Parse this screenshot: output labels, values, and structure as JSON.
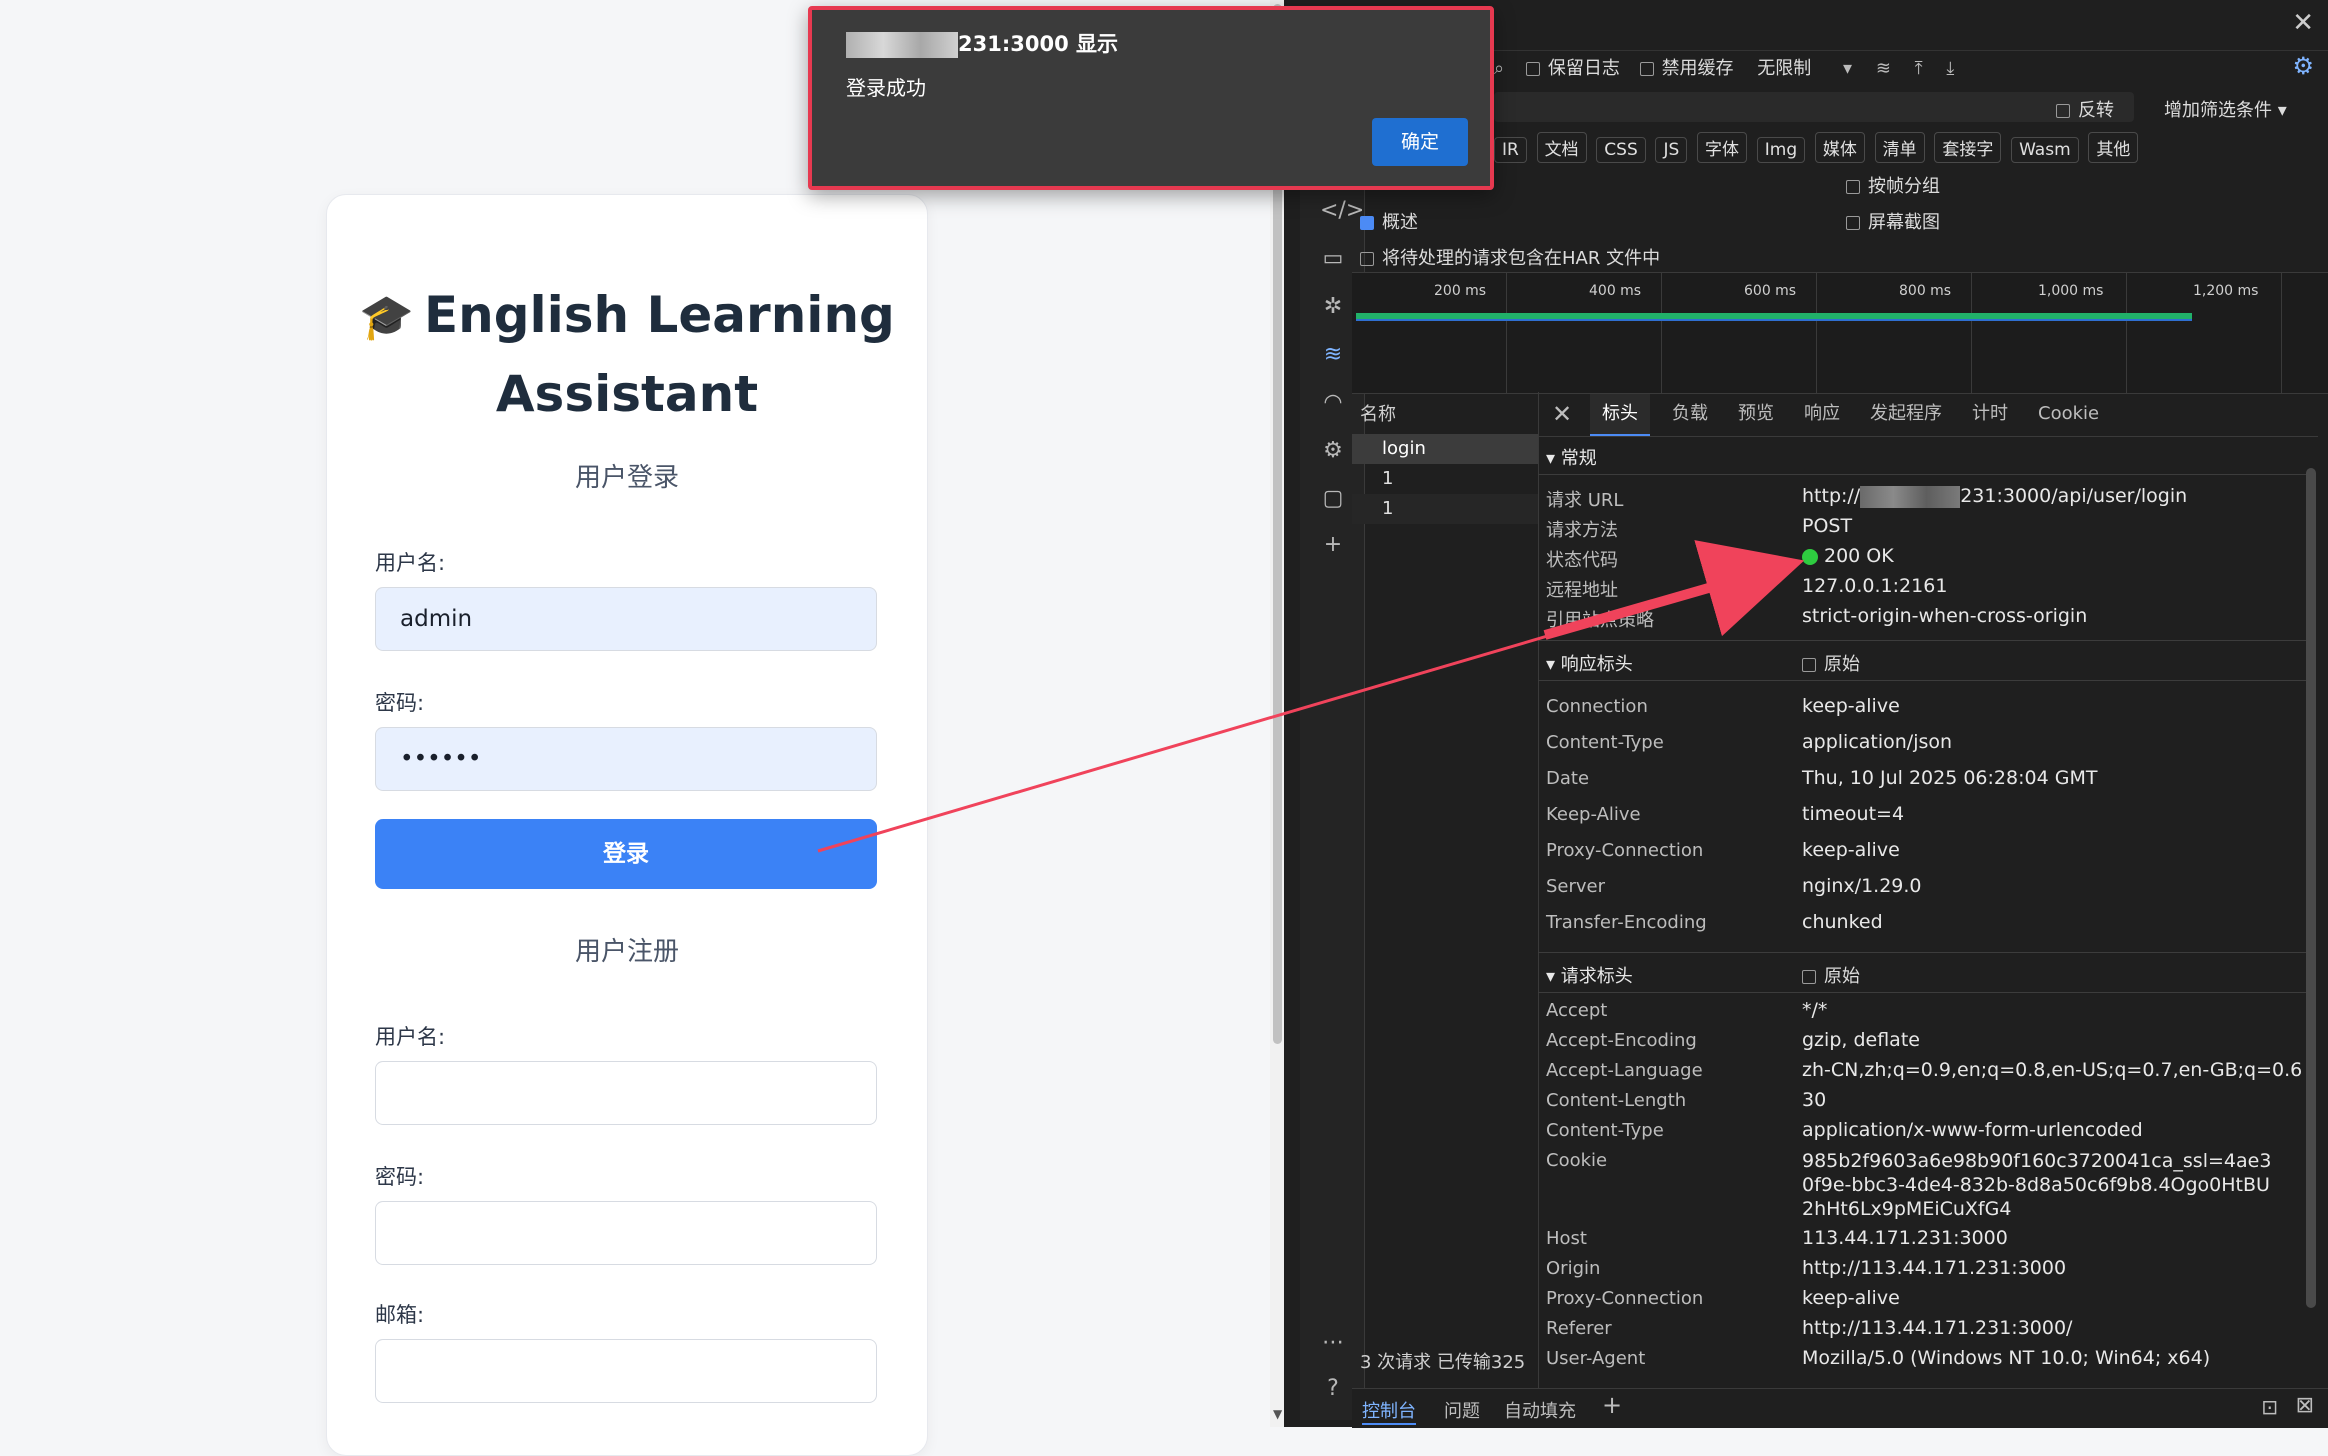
{
  "login_page": {
    "title_icon": "graduation-cap-icon",
    "title_line1": "English Learning",
    "title_line2": "Assistant",
    "login_heading": "用户登录",
    "username_label": "用户名:",
    "username_value": "admin",
    "password_label": "密码:",
    "password_value": "••••••",
    "login_button": "登录",
    "register_heading": "用户注册",
    "reg_username_label": "用户名:",
    "reg_password_label": "密码:",
    "reg_email_label": "邮箱:"
  },
  "dialog": {
    "origin_suffix": "231:3000 显示",
    "message": "登录成功",
    "ok_button": "确定"
  },
  "devtools": {
    "toolbar": {
      "preserve_log": "保留日志",
      "disable_cache": "禁用缓存",
      "throttle": "无限制",
      "invert": "反转",
      "more_filters": "增加筛选条件"
    },
    "filter_types": [
      "IR",
      "文档",
      "CSS",
      "JS",
      "字体",
      "Img",
      "媒体",
      "清单",
      "套接字",
      "Wasm",
      "其他"
    ],
    "options": {
      "group_by_frame": "按帧分组",
      "overview": "概述",
      "screenshots": "屏幕截图",
      "har_pending": "将待处理的请求包含在HAR 文件中"
    },
    "timeline_ticks": [
      "200 ms",
      "400 ms",
      "600 ms",
      "800 ms",
      "1,000 ms",
      "1,200 ms"
    ],
    "request_list": {
      "header": "名称",
      "rows": [
        "login",
        "1",
        "1"
      ],
      "status": "3 次请求  已传输325"
    },
    "detail_tabs": [
      "标头",
      "负载",
      "预览",
      "响应",
      "发起程序",
      "计时",
      "Cookie"
    ],
    "general": {
      "title": "常规",
      "rows": [
        {
          "key": "请求 URL",
          "value_suffix": "231:3000/api/user/login",
          "value_prefix": "http://"
        },
        {
          "key": "请求方法",
          "value": "POST"
        },
        {
          "key": "状态代码",
          "value": "200 OK"
        },
        {
          "key": "远程地址",
          "value": "127.0.0.1:2161"
        },
        {
          "key": "引用站点策略",
          "value": "strict-origin-when-cross-origin"
        }
      ]
    },
    "response_headers": {
      "title": "响应标头",
      "raw": "原始",
      "rows": [
        {
          "key": "Connection",
          "value": "keep-alive"
        },
        {
          "key": "Content-Type",
          "value": "application/json"
        },
        {
          "key": "Date",
          "value": "Thu, 10 Jul 2025 06:28:04 GMT"
        },
        {
          "key": "Keep-Alive",
          "value": "timeout=4"
        },
        {
          "key": "Proxy-Connection",
          "value": "keep-alive"
        },
        {
          "key": "Server",
          "value": "nginx/1.29.0"
        },
        {
          "key": "Transfer-Encoding",
          "value": "chunked"
        }
      ]
    },
    "request_headers": {
      "title": "请求标头",
      "raw": "原始",
      "rows": [
        {
          "key": "Accept",
          "value": "*/*"
        },
        {
          "key": "Accept-Encoding",
          "value": "gzip, deflate"
        },
        {
          "key": "Accept-Language",
          "value": "zh-CN,zh;q=0.9,en;q=0.8,en-US;q=0.7,en-GB;q=0.6"
        },
        {
          "key": "Content-Length",
          "value": "30"
        },
        {
          "key": "Content-Type",
          "value": "application/x-www-form-urlencoded"
        },
        {
          "key": "Cookie",
          "value": "985b2f9603a6e98b90f160c3720041ca_ssl=4ae30f9e-bbc3-4de4-832b-8d8a50c6f9b8.4Ogo0HtBU2hHt6Lx9pMEiCuXfG4"
        },
        {
          "key": "Host",
          "value": "113.44.171.231:3000"
        },
        {
          "key": "Origin",
          "value": "http://113.44.171.231:3000"
        },
        {
          "key": "Proxy-Connection",
          "value": "keep-alive"
        },
        {
          "key": "Referer",
          "value": "http://113.44.171.231:3000/"
        },
        {
          "key": "User-Agent",
          "value": "Mozilla/5.0 (Windows NT 10.0; Win64; x64)"
        }
      ]
    },
    "drawer_tabs": [
      "控制台",
      "问题",
      "自动填充"
    ],
    "colors": {
      "status_ok": "#2ecc40",
      "accent": "#4c8bf5",
      "annotation": "#f0435b"
    }
  }
}
